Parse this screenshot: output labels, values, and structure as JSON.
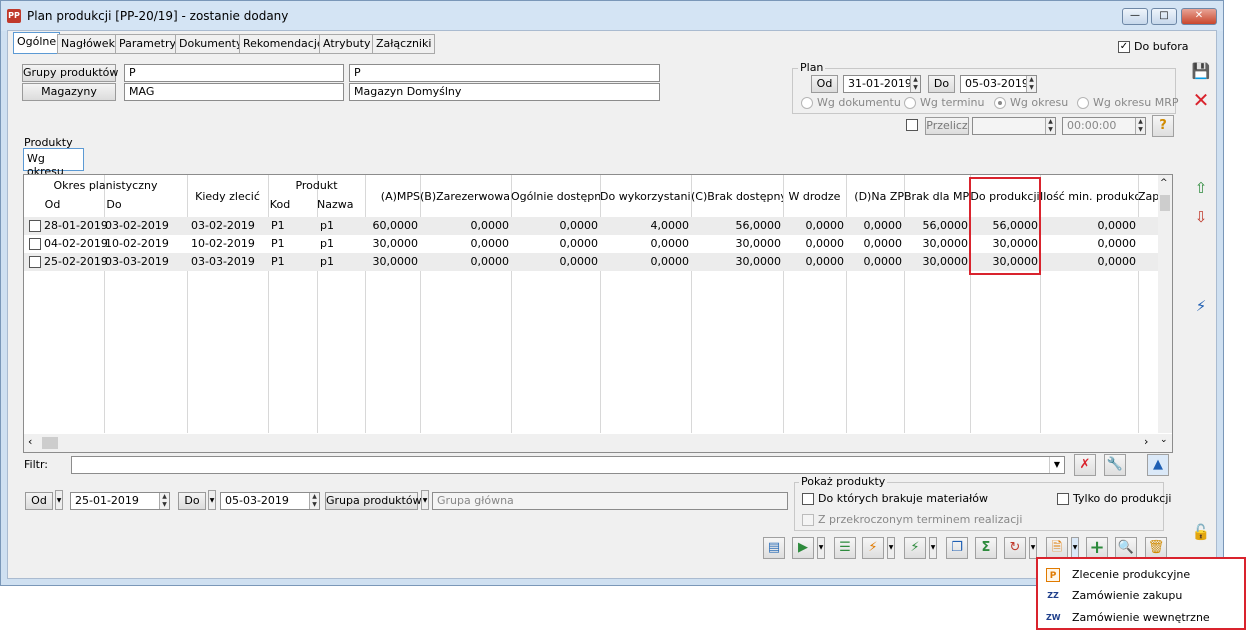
{
  "window": {
    "title": "Plan produkcji [PP-20/19] - zostanie dodany",
    "app_icon": "PP"
  },
  "tabs": [
    {
      "label": "Ogólne",
      "active": true
    },
    {
      "label": "Nagłówek"
    },
    {
      "label": "Parametry"
    },
    {
      "label": "Dokumenty"
    },
    {
      "label": "Rekomendacje"
    },
    {
      "label": "Atrybuty"
    },
    {
      "label": "Załączniki"
    }
  ],
  "do_bufora": {
    "label": "Do bufora",
    "checked": true,
    "mark": "✓"
  },
  "header": {
    "grupy_button": "Grupy produktów",
    "grupy_code": "P",
    "grupy_name": "P",
    "magazyny_button": "Magazyny",
    "magazyn_code": "MAG",
    "magazyn_name": "Magazyn Domyślny"
  },
  "plan": {
    "group_label": "Plan",
    "od_label": "Od",
    "od_value": "31-01-2019",
    "do_label": "Do",
    "do_value": "05-03-2019",
    "radios": [
      {
        "label": "Wg dokumentu",
        "selected": false
      },
      {
        "label": "Wg terminu",
        "selected": false
      },
      {
        "label": "Wg okresu",
        "selected": true
      },
      {
        "label": "Wg okresu MRP",
        "selected": false
      }
    ],
    "przelicz_label": "Przelicz",
    "time_value": "00:00:00"
  },
  "produkty": {
    "group_label": "Produkty",
    "subtab": "Wg okresu"
  },
  "table": {
    "group_headers": {
      "okres": "Okres planistyczny",
      "produkt": "Produkt"
    },
    "headers": [
      "Od",
      "Do",
      "Kiedy zlecić",
      "Kod",
      "Nazwa",
      "(A)MPS",
      "(B)Zarezerwowana",
      "Ogólnie dostępna",
      "Do wykorzystania",
      "(C)Brak dostępnych",
      "W drodze",
      "(D)Na ZP",
      "Brak dla MPS",
      "Do produkcji",
      "Ilość min. produkcji",
      "Zap"
    ],
    "rows": [
      [
        "28-01-2019",
        "03-02-2019",
        "03-02-2019",
        "P1",
        "p1",
        "60,0000",
        "0,0000",
        "0,0000",
        "4,0000",
        "56,0000",
        "0,0000",
        "0,0000",
        "56,0000",
        "56,0000",
        "0,0000"
      ],
      [
        "04-02-2019",
        "10-02-2019",
        "10-02-2019",
        "P1",
        "p1",
        "30,0000",
        "0,0000",
        "0,0000",
        "0,0000",
        "30,0000",
        "0,0000",
        "0,0000",
        "30,0000",
        "30,0000",
        "0,0000"
      ],
      [
        "25-02-2019",
        "03-03-2019",
        "03-03-2019",
        "P1",
        "p1",
        "30,0000",
        "0,0000",
        "0,0000",
        "0,0000",
        "30,0000",
        "0,0000",
        "0,0000",
        "30,0000",
        "30,0000",
        "0,0000"
      ]
    ]
  },
  "filter": {
    "label": "Filtr:",
    "value": ""
  },
  "bottom": {
    "od_label": "Od",
    "od_value": "25-01-2019",
    "do_label": "Do",
    "do_value": "05-03-2019",
    "grupa_button": "Grupa produktów",
    "grupa_value": "Grupa główna"
  },
  "pokaz": {
    "group_label": "Pokaż produkty",
    "brakuje": "Do których brakuje materiałów",
    "tylko": "Tylko do produkcji",
    "przekroczonym": "Z przekroczonym terminem realizacji"
  },
  "context_menu": {
    "items": [
      {
        "label": "Zlecenie produkcyjne",
        "icon": "P",
        "icon_name": "production-order-icon"
      },
      {
        "label": "Zamówienie zakupu",
        "icon": "ZZ",
        "icon_name": "purchase-order-icon"
      },
      {
        "label": "Zamówienie wewnętrzne",
        "icon": "ZW",
        "icon_name": "internal-order-icon"
      }
    ]
  },
  "colors": {
    "highlight": "#d9232d",
    "accent": "#1f5fb3",
    "window": "#cfe0f1"
  }
}
